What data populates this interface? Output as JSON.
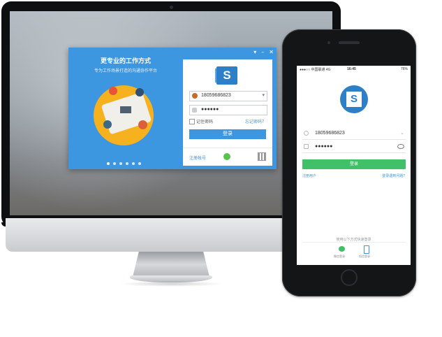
{
  "desktop": {
    "window_controls": [
      "▾",
      "–",
      "✕"
    ],
    "headline": "更专业的工作方式",
    "subline": "专为工作场景打造的沟通协作平台",
    "slides": 6,
    "active_slide": 0,
    "username": "18059686823",
    "password_masked": "●●●●●●",
    "remember_label": "记住密码",
    "forgot_label": "忘记密码？",
    "login_label": "登录",
    "register_label": "注册帐号",
    "logo_letter": "S",
    "colors": {
      "accent": "#3d97e0",
      "logo": "#2d7fc7"
    }
  },
  "phone": {
    "status": {
      "carrier": "●●●○○ 中国联通 4G",
      "time": "16:45",
      "battery": "76%"
    },
    "logo_letter": "S",
    "username": "18059686823",
    "password_masked": "●●●●●●",
    "login_label": "登录",
    "register_label": "注册用户",
    "problem_label": "登录遇到问题?",
    "quick_login_label": "使用以下方式快速登录",
    "wechat_label": "微信登录",
    "sms_label": "短信登录",
    "colors": {
      "login": "#41bf69"
    }
  }
}
